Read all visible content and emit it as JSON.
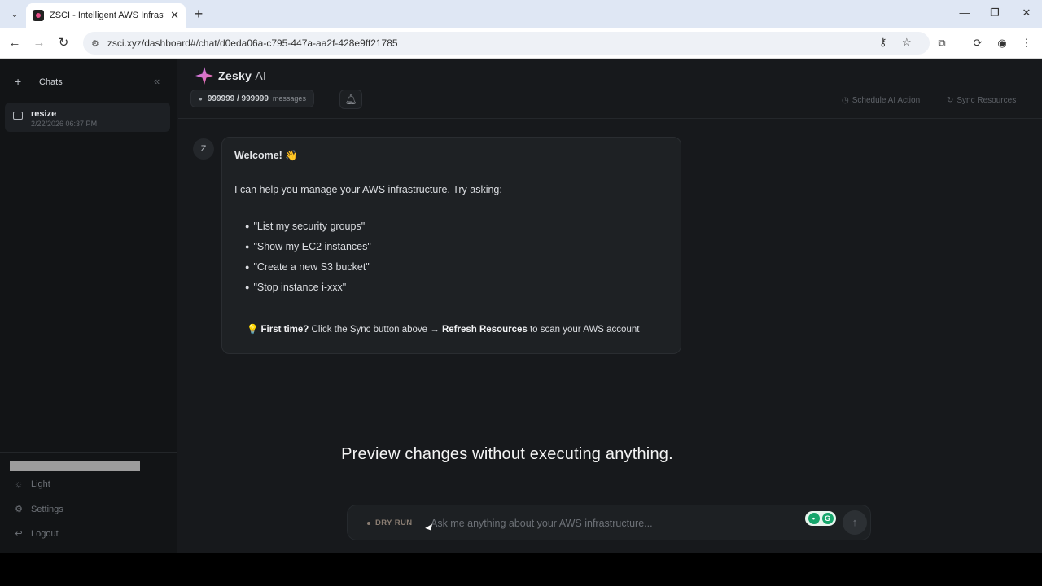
{
  "browser": {
    "tab_title": "ZSCI - Intelligent AWS Infrastructure",
    "url": "zsci.xyz/dashboard#/chat/d0eda06a-c795-447a-aa2f-428e9ff21785"
  },
  "sidebar": {
    "title": "Chats",
    "chats": [
      {
        "name": "resize",
        "date": "2/22/2026 06:37 PM"
      }
    ],
    "footer": {
      "theme_label": "Light",
      "settings_label": "Settings",
      "logout_label": "Logout"
    }
  },
  "header": {
    "brand": "Zesky",
    "brand_suffix": "AI",
    "message_count": "999999 / 999999",
    "message_unit": "messages",
    "schedule_label": "Schedule AI Action",
    "sync_label": "Sync Resources"
  },
  "chat": {
    "avatar_letter": "Z",
    "welcome": "Welcome! 👋",
    "intro": "I can help you manage your AWS infrastructure. Try asking:",
    "suggestions": [
      "\"List my security groups\"",
      "\"Show my EC2 instances\"",
      "\"Create a new S3 bucket\"",
      "\"Stop instance i-xxx\""
    ],
    "tip_icon": "💡",
    "tip_bold_1": "First time?",
    "tip_text_1": " Click the Sync button above → ",
    "tip_bold_2": "Refresh Resources",
    "tip_text_2": " to scan your AWS account"
  },
  "caption": "Preview changes without executing anything.",
  "composer": {
    "mode_label": "DRY RUN",
    "placeholder": "Ask me anything about your AWS infrastructure..."
  }
}
